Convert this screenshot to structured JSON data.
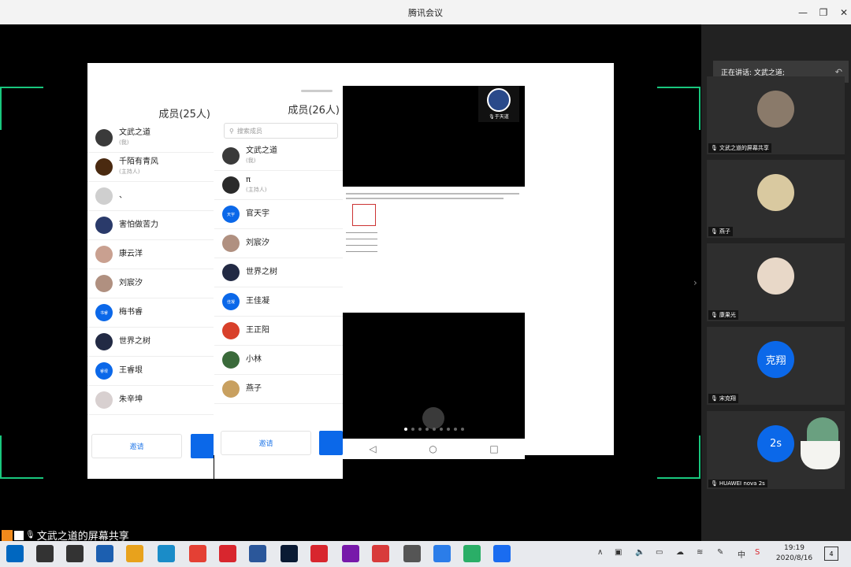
{
  "window": {
    "title": "腾讯会议"
  },
  "speaking": {
    "label": "正在讲话: 文武之道;"
  },
  "share_caption": "文武之道的屏幕共享",
  "left_panel": {
    "title": "成员(25人)",
    "invite": "邀请",
    "members": [
      {
        "name": "文武之道",
        "sub": "(我)",
        "color": "#3a3a3a"
      },
      {
        "name": "千陌有青风",
        "sub": "(主持人)",
        "color": "#4a2a10"
      },
      {
        "name": "、",
        "sub": "",
        "color": "#cfcfcf"
      },
      {
        "name": "害怕做苦力",
        "sub": "",
        "color": "#2a3a6a"
      },
      {
        "name": "康云洋",
        "sub": "",
        "color": "#c9a090"
      },
      {
        "name": "刘宸汐",
        "sub": "",
        "color": "#b09080"
      },
      {
        "name": "梅书睿",
        "sub": "",
        "color": "#0b68e9",
        "initials": "书睿"
      },
      {
        "name": "世界之树",
        "sub": "",
        "color": "#222a44"
      },
      {
        "name": "王睿垠",
        "sub": "",
        "color": "#0b68e9",
        "initials": "睿垠"
      },
      {
        "name": "朱辛坤",
        "sub": "",
        "color": "#d8d0d0"
      }
    ]
  },
  "mid_panel": {
    "title": "成员(26人)",
    "search_placeholder": "搜索成员",
    "invite": "邀请",
    "members": [
      {
        "name": "文武之道",
        "sub": "(我)",
        "color": "#3a3a3a"
      },
      {
        "name": "π",
        "sub": "(主持人)",
        "color": "#2a2a2a"
      },
      {
        "name": "官天宇",
        "sub": "",
        "color": "#0b68e9",
        "initials": "天宇"
      },
      {
        "name": "刘宸汐",
        "sub": "",
        "color": "#b09080"
      },
      {
        "name": "世界之树",
        "sub": "",
        "color": "#222a44"
      },
      {
        "name": "王佳凝",
        "sub": "",
        "color": "#0b68e9",
        "initials": "佳凝"
      },
      {
        "name": "王正阳",
        "sub": "",
        "color": "#d8402a"
      },
      {
        "name": "小林",
        "sub": "",
        "color": "#3a6a3a"
      },
      {
        "name": "燕子",
        "sub": "",
        "color": "#c8a060"
      }
    ]
  },
  "phone": {
    "speaker_name": "于天道"
  },
  "tiles": [
    {
      "name": "文武之道的屏幕共享",
      "avatar_text": "",
      "color": "#8a7a6a",
      "icon": "cup-icon"
    },
    {
      "name": "燕子",
      "avatar_text": "",
      "color": "#d9c9a0",
      "icon": "person-photo"
    },
    {
      "name": "康果光",
      "avatar_text": "",
      "color": "#e8d8c8",
      "icon": "person-photo"
    },
    {
      "name": "宋克翔",
      "avatar_text": "克翔",
      "color": "#0b68e9"
    },
    {
      "name": "HUAWEI nova 2s",
      "avatar_text": "2s",
      "color": "#0b68e9"
    }
  ],
  "taskbar": {
    "time": "19:19",
    "date": "2020/8/16",
    "ime": "中",
    "notification_count": "4",
    "apps": [
      {
        "icon": "windows-start-icon",
        "color": "#0067c0"
      },
      {
        "icon": "search-icon",
        "color": "#333"
      },
      {
        "icon": "task-view-icon",
        "color": "#333"
      },
      {
        "icon": "store-icon",
        "color": "#1c5fb0"
      },
      {
        "icon": "explorer-icon",
        "color": "#e8a21c"
      },
      {
        "icon": "edge-icon",
        "color": "#1a8cc8"
      },
      {
        "icon": "chrome-icon",
        "color": "#e44034"
      },
      {
        "icon": "app-red-icon",
        "color": "#d8262e"
      },
      {
        "icon": "word-icon",
        "color": "#2b579a"
      },
      {
        "icon": "photoshop-icon",
        "color": "#0a1a33"
      },
      {
        "icon": "app-note-icon",
        "color": "#d8262e"
      },
      {
        "icon": "onenote-icon",
        "color": "#7719aa"
      },
      {
        "icon": "app-bookmark-icon",
        "color": "#d83b3b"
      },
      {
        "icon": "app-dark-icon",
        "color": "#555"
      },
      {
        "icon": "wps-icon",
        "color": "#2b7de9"
      },
      {
        "icon": "wechat-icon",
        "color": "#2aae67"
      },
      {
        "icon": "tencent-meeting-icon",
        "color": "#1a6cf0"
      }
    ]
  }
}
